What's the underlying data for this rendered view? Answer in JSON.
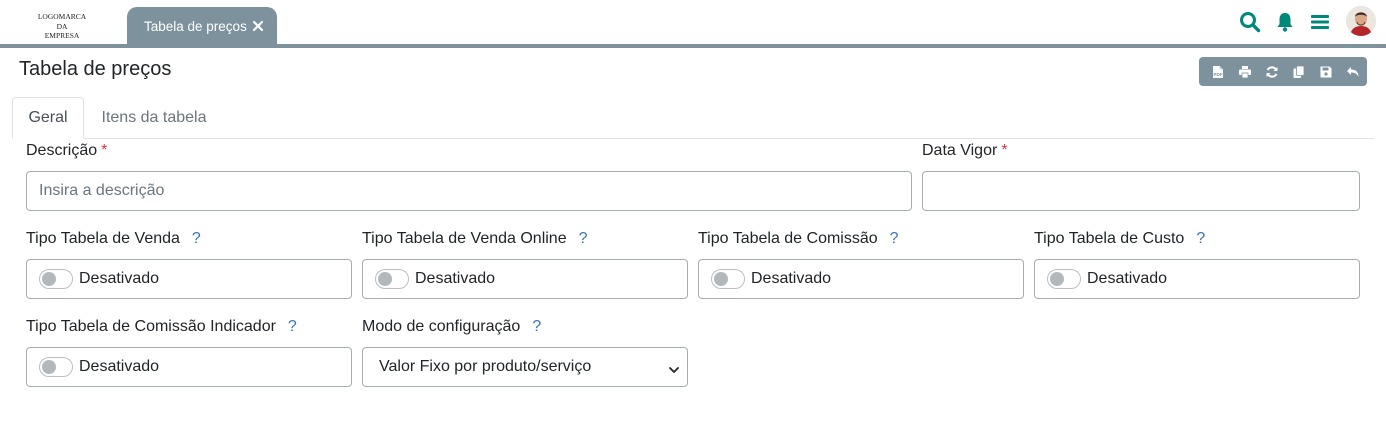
{
  "logo": {
    "line1": "LOGOMARCA",
    "line2": "DA",
    "line3": "EMPRESA"
  },
  "doc_tab": {
    "label": "Tabela de preços"
  },
  "top_icons": [
    "search-icon",
    "bell-icon",
    "menu-icon",
    "avatar"
  ],
  "page": {
    "title": "Tabela de preços"
  },
  "toolbar": {
    "icons": [
      "pdf-icon",
      "print-icon",
      "refresh-icon",
      "copy-icon",
      "save-icon",
      "undo-icon"
    ]
  },
  "tabs": [
    {
      "label": "Geral",
      "active": true
    },
    {
      "label": "Itens da tabela",
      "active": false
    }
  ],
  "form": {
    "descricao": {
      "label": "Descrição",
      "required": "*",
      "placeholder": "Insira a descrição",
      "value": ""
    },
    "data_vigor": {
      "label": "Data Vigor",
      "required": "*",
      "value": ""
    },
    "toggles": [
      {
        "label": "Tipo Tabela de Venda",
        "help": "?",
        "state": "Desativado"
      },
      {
        "label": "Tipo Tabela de Venda Online",
        "help": "?",
        "state": "Desativado"
      },
      {
        "label": "Tipo Tabela de Comissão",
        "help": "?",
        "state": "Desativado"
      },
      {
        "label": "Tipo Tabela de Custo",
        "help": "?",
        "state": "Desativado"
      },
      {
        "label": "Tipo Tabela de Comissão Indicador",
        "help": "?",
        "state": "Desativado"
      }
    ],
    "modo": {
      "label": "Modo de configuração",
      "help": "?",
      "selected": "Valor Fixo por produto/serviço"
    }
  },
  "colors": {
    "accent": "#00897b",
    "tab_bg": "#7d929c",
    "required": "#dc3545",
    "help": "#3a74b5"
  }
}
